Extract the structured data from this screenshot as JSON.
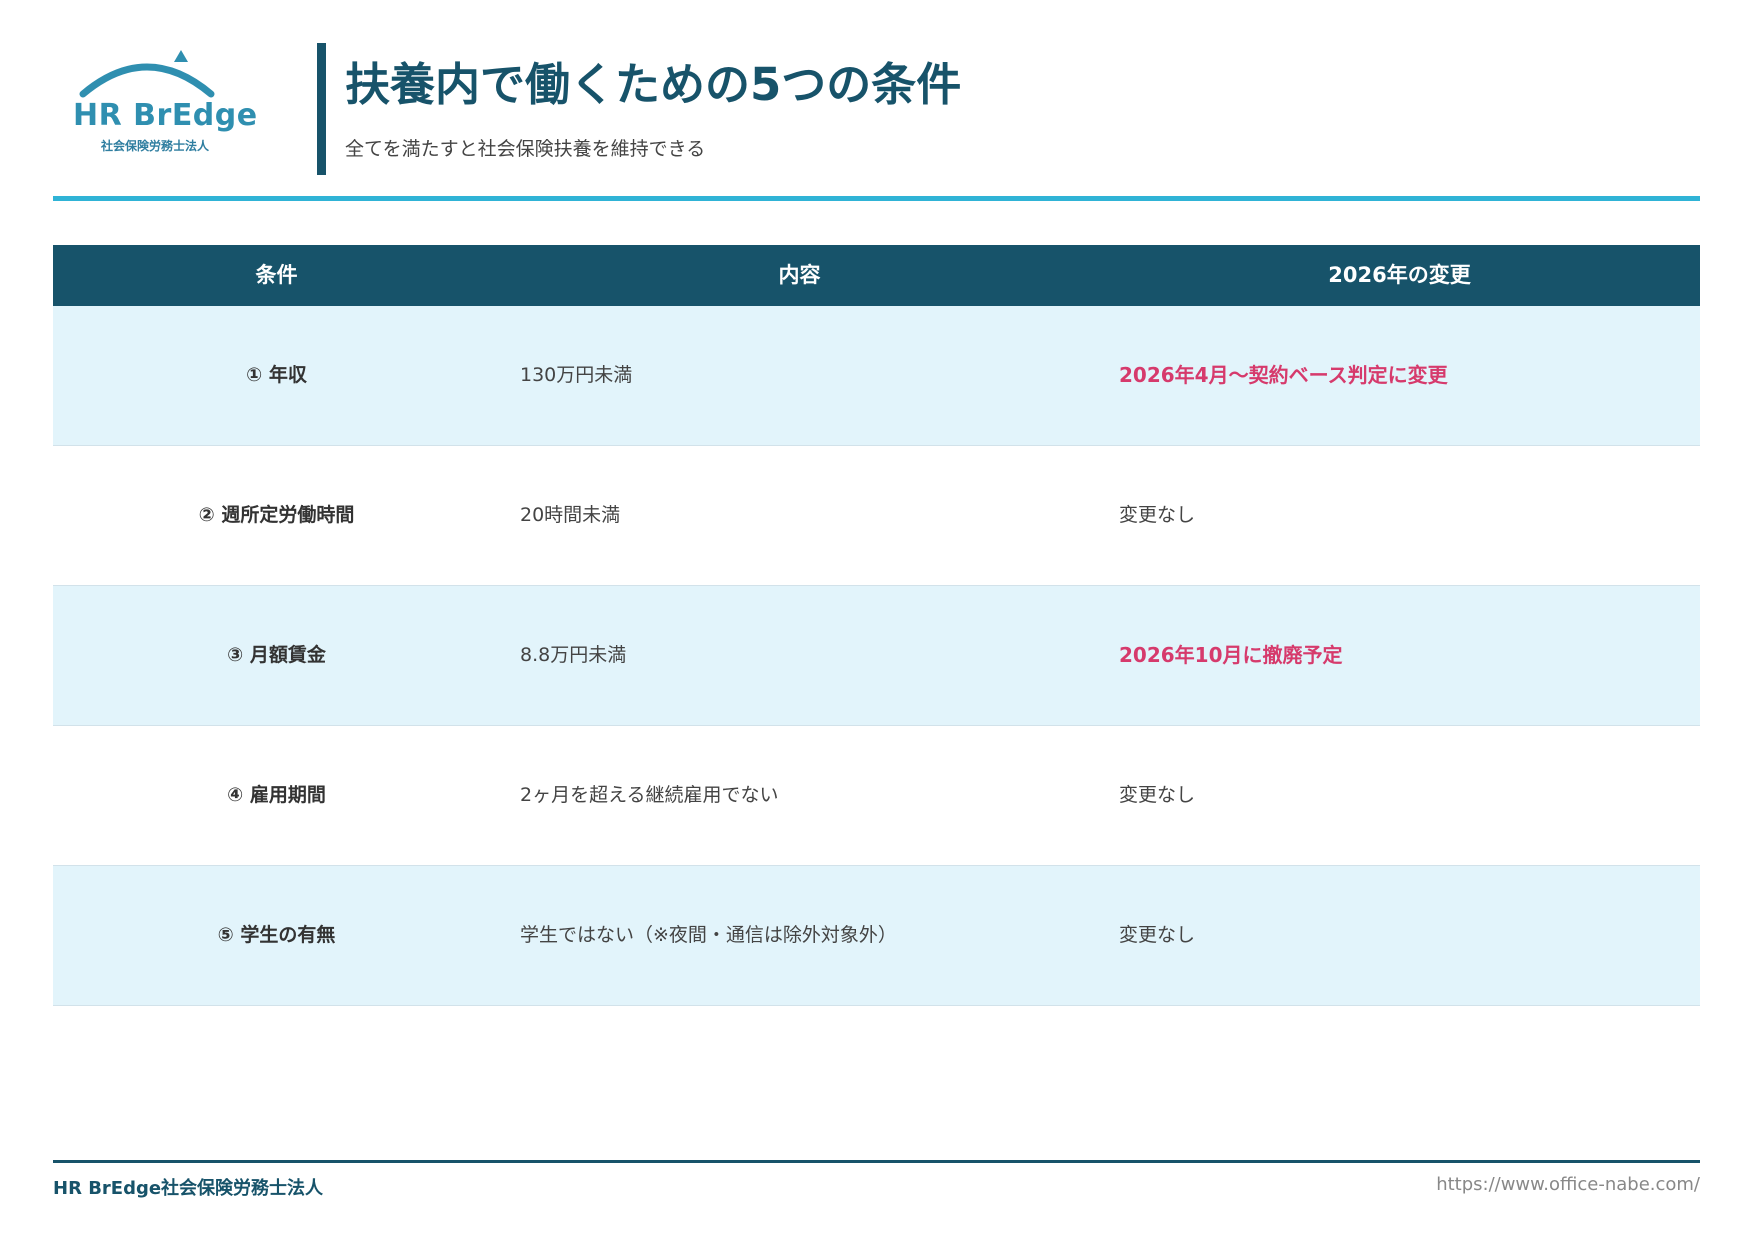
{
  "header": {
    "logo_text": "HR BrEdge",
    "logo_subtext": "社会保険労務士法人",
    "title": "扶養内で働くための5つの条件",
    "subtitle": "全てを満たすと社会保険扶養を維持できる"
  },
  "table": {
    "columns": [
      "条件",
      "内容",
      "2026年の変更"
    ],
    "rows": [
      {
        "condition": "① 年収",
        "content": "130万円未満",
        "change": "2026年4月〜契約ベース判定に変更",
        "highlight": true
      },
      {
        "condition": "② 週所定労働時間",
        "content": "20時間未満",
        "change": "変更なし",
        "highlight": false
      },
      {
        "condition": "③ 月額賃金",
        "content": "8.8万円未満",
        "change": "2026年10月に撤廃予定",
        "highlight": true
      },
      {
        "condition": "④ 雇用期間",
        "content": "2ヶ月を超える継続雇用でない",
        "change": "変更なし",
        "highlight": false
      },
      {
        "condition": "⑤ 学生の有無",
        "content": "学生ではない（※夜間・通信は除外対象外）",
        "change": "変更なし",
        "highlight": false
      }
    ]
  },
  "footer": {
    "company": "HR BrEdge社会保険労務士法人",
    "url": "https://www.office-nabe.com/"
  },
  "colors": {
    "primary": "#17536a",
    "accent_rule": "#2fb3d6",
    "row_alt": "#e2f4fb",
    "highlight": "#d63a6c",
    "logo": "#2f8fb0"
  }
}
